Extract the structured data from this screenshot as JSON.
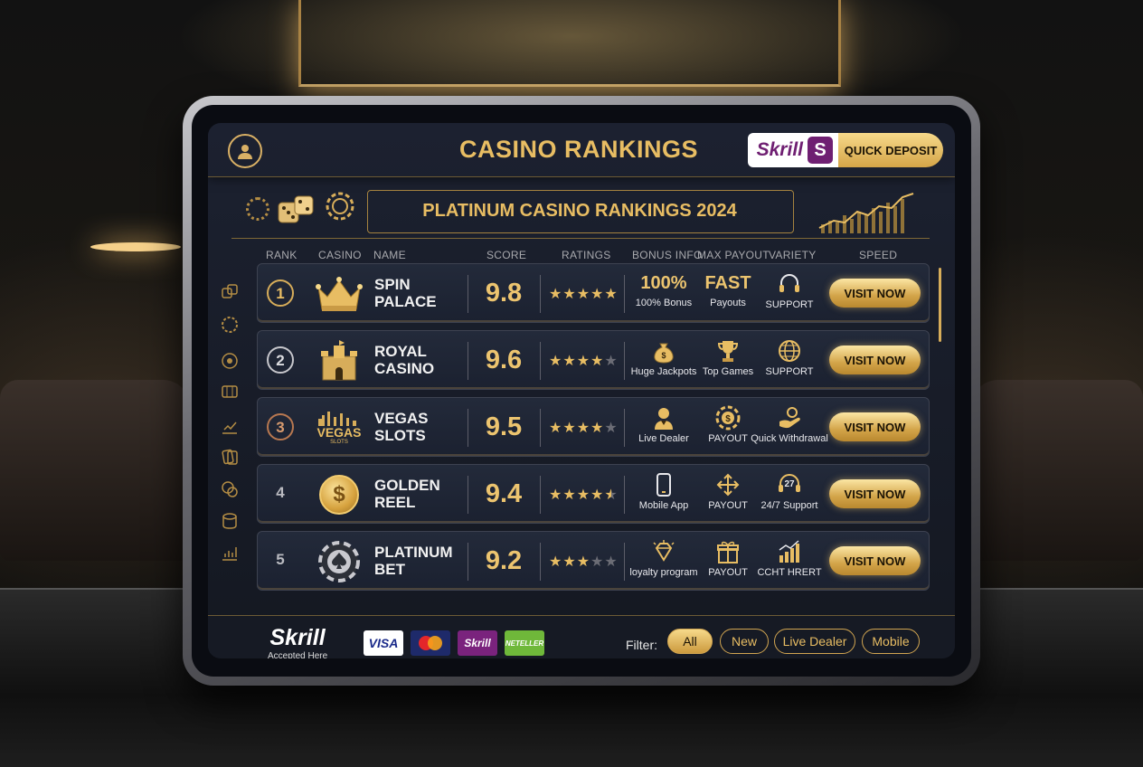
{
  "header": {
    "title": "CASINO RANKINGS",
    "skrill_logo": "Skrill",
    "skrill_badge": "S",
    "quick_deposit_label": "QUICK DEPOSIT"
  },
  "banner": {
    "title": "PLATINUM CASINO RANKINGS 2024"
  },
  "columns": [
    "RANK",
    "CASINO",
    "NAME",
    "SCORE",
    "RATINGS",
    "BONUS INFO",
    "MAX PAYOUT",
    "VARIETY",
    "SPEED"
  ],
  "rows": [
    {
      "rank": "1",
      "name_line1": "SPIN",
      "name_line2": "PALACE",
      "score": "9.8",
      "stars": 5,
      "bonus_big": "100%",
      "bonus_label": "100% Bonus",
      "payout_big": "FAST",
      "payout_label": "Payouts",
      "variety_label": "SUPPORT",
      "visit_label": "VISIT NOW"
    },
    {
      "rank": "2",
      "name_line1": "ROYAL",
      "name_line2": "CASINO",
      "score": "9.6",
      "stars": 4,
      "bonus_label": "Huge Jackpots",
      "payout_label": "Top Games",
      "variety_label": "SUPPORT",
      "visit_label": "VISIT NOW"
    },
    {
      "rank": "3",
      "name_line1": "VEGAS",
      "name_line2": "SLOTS",
      "score": "9.5",
      "stars": 4,
      "logo_text": "VEGAS",
      "logo_sub": "SLOTS",
      "bonus_label": "Live Dealer",
      "payout_label": "PAYOUT",
      "variety_label": "Quick Withdrawal",
      "visit_label": "VISIT NOW"
    },
    {
      "rank": "4",
      "name_line1": "GOLDEN",
      "name_line2": "REEL",
      "score": "9.4",
      "stars": 4.5,
      "logo_text": "$",
      "bonus_label": "Mobile App",
      "payout_label": "PAYOUT",
      "variety_icon_text": "27",
      "variety_label": "24/7 Support",
      "visit_label": "VISIT NOW"
    },
    {
      "rank": "5",
      "name_line1": "PLATINUM",
      "name_line2": "BET",
      "score": "9.2",
      "stars": 3,
      "bonus_label": "loyalty program",
      "payout_label": "PAYOUT",
      "variety_label": "CCHT HRERT",
      "visit_label": "VISIT NOW"
    }
  ],
  "footer": {
    "skrill_word": "Skrill",
    "skrill_sub": "Accepted Here",
    "payments": [
      "VISA",
      "",
      "Skrill",
      "NETELLER"
    ],
    "filter_label": "Filter:",
    "filters": [
      "All",
      "New",
      "Live Dealer",
      "Mobile"
    ]
  },
  "colors": {
    "gold": "#e8bd63",
    "panel": "#1c2130",
    "skrill": "#6f1f72"
  }
}
